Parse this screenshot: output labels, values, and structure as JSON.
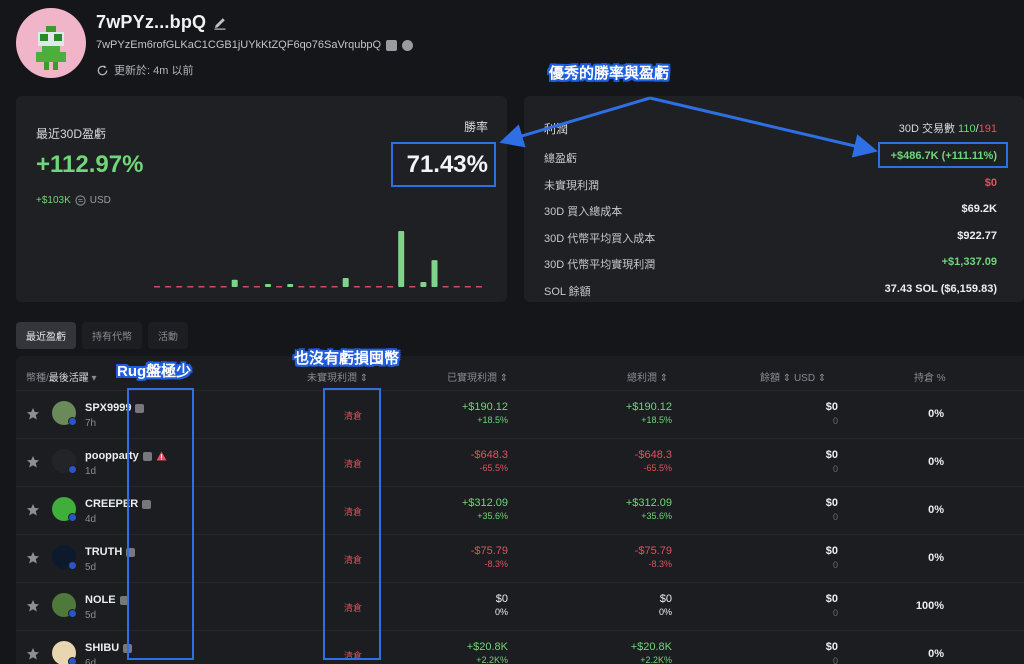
{
  "profile": {
    "name": "7wPYz...bpQ",
    "address": "7wPYzEm6rofGLKaC1CGB1jUYkKtZQF6qo76SaVrqubpQ",
    "updated": "更新於: 4m 以前"
  },
  "pnl_card": {
    "label": "最近30D盈虧",
    "value": "+112.97%",
    "usd_value": "+$103K",
    "usd_label": "USD",
    "winrate_label": "勝率",
    "winrate_value": "71.43%",
    "histogram": {
      "green_levels": [
        0.0,
        0.0,
        0.0,
        0.0,
        0.0,
        0.0,
        0.0,
        0.13,
        0.0,
        0.0,
        0.05,
        0.0,
        0.05,
        0.0,
        0.0,
        0.0,
        0.0,
        0.16,
        0.0,
        0.0,
        0.0,
        0.0,
        1.0,
        0.0,
        0.09,
        0.48,
        0.0,
        0.0,
        0.0,
        0.0
      ],
      "red_flags": [
        1,
        1,
        1,
        1,
        1,
        1,
        1,
        0,
        1,
        1,
        0,
        1,
        0,
        1,
        1,
        1,
        1,
        0,
        1,
        1,
        1,
        1,
        0,
        1,
        0,
        0,
        1,
        1,
        1,
        1
      ]
    }
  },
  "profit_card": {
    "title": "利潤",
    "trades_label": "30D 交易數",
    "trades_win": "110",
    "trades_sep": "/",
    "trades_total": "191",
    "rows": [
      {
        "label": "總盈虧",
        "value": "+$486.7K (+111.11%)",
        "tone": "g"
      },
      {
        "label": "未實現利潤",
        "value": "$0",
        "tone": "r"
      },
      {
        "label": "30D 買入總成本",
        "value": "$69.2K",
        "tone": "w"
      },
      {
        "label": "30D 代幣平均買入成本",
        "value": "$922.77",
        "tone": "w"
      },
      {
        "label": "30D 代幣平均實現利潤",
        "value": "+$1,337.09",
        "tone": "g"
      },
      {
        "label": "SOL 餘額",
        "value": "37.43 SOL ($6,159.83)",
        "tone": "w"
      }
    ]
  },
  "tabs": [
    "最近盈虧",
    "持有代幣",
    "活動"
  ],
  "table": {
    "headers": {
      "token_pre": "幣種/",
      "token_sort": "最後活躍",
      "unrealized": "未實現利潤",
      "realized": "已實現利潤",
      "total": "總利潤",
      "balance": "餘額",
      "usd": "USD",
      "hold": "持倉 %"
    },
    "rows": [
      {
        "name": "SPX9999",
        "age": "7h",
        "status": "清倉",
        "realized": "+$190.12",
        "realized_pct": "+18.5%",
        "total": "+$190.12",
        "total_pct": "+18.5%",
        "tone": "g",
        "balance": "$0",
        "balance_sub": "0",
        "hold": "0%",
        "warn": false,
        "avatar": "#6a8a5a"
      },
      {
        "name": "poopparty",
        "age": "1d",
        "status": "清倉",
        "realized": "-$648.3",
        "realized_pct": "-65.5%",
        "total": "-$648.3",
        "total_pct": "-65.5%",
        "tone": "r",
        "balance": "$0",
        "balance_sub": "0",
        "hold": "0%",
        "warn": true,
        "avatar": "#222428"
      },
      {
        "name": "CREEPER",
        "age": "4d",
        "status": "清倉",
        "realized": "+$312.09",
        "realized_pct": "+35.6%",
        "total": "+$312.09",
        "total_pct": "+35.6%",
        "tone": "g",
        "balance": "$0",
        "balance_sub": "0",
        "hold": "0%",
        "warn": false,
        "avatar": "#3fae3a"
      },
      {
        "name": "TRUTH",
        "age": "5d",
        "status": "清倉",
        "realized": "-$75.79",
        "realized_pct": "-8.3%",
        "total": "-$75.79",
        "total_pct": "-8.3%",
        "tone": "r",
        "balance": "$0",
        "balance_sub": "0",
        "hold": "0%",
        "warn": false,
        "avatar": "#0d1a2e"
      },
      {
        "name": "NOLE",
        "age": "5d",
        "status": "清倉",
        "realized": "$0",
        "realized_pct": "0%",
        "total": "$0",
        "total_pct": "0%",
        "tone": "w",
        "balance": "$0",
        "balance_sub": "0",
        "hold": "100%",
        "warn": false,
        "avatar": "#4d7a3a"
      },
      {
        "name": "SHIBU",
        "age": "6d",
        "status": "清倉",
        "realized": "+$20.8K",
        "realized_pct": "+2.2K%",
        "total": "+$20.8K",
        "total_pct": "+2.2K%",
        "tone": "g",
        "balance": "$0",
        "balance_sub": "0",
        "hold": "0%",
        "warn": false,
        "avatar": "#e8d6b0"
      }
    ]
  },
  "annotations": {
    "winrate_note": "優秀的勝率與盈虧",
    "rug_note": "Rug盤極少",
    "loss_note": "也沒有虧損囤幣"
  },
  "colors": {
    "accent_green": "#6fd67a",
    "accent_red": "#e0525f",
    "annotation_blue": "#2f6fe4"
  }
}
